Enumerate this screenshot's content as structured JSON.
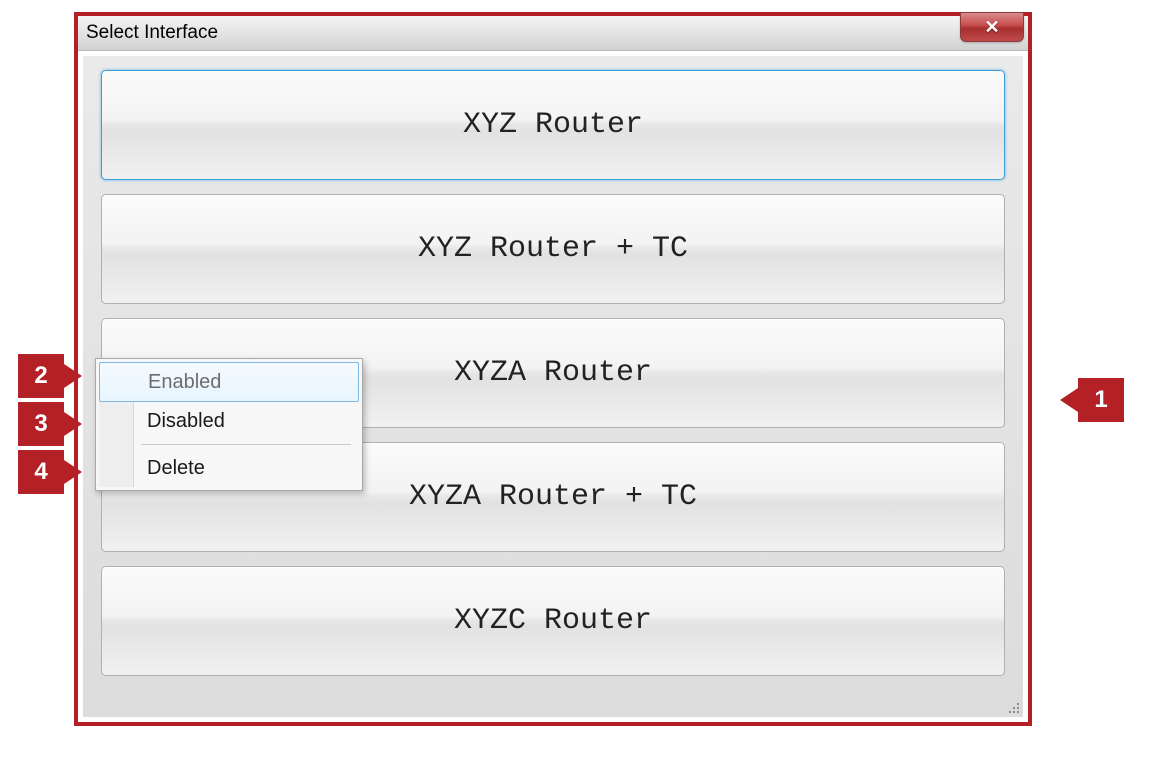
{
  "window": {
    "title": "Select Interface"
  },
  "interfaces": [
    {
      "label": "XYZ Router",
      "selected": true
    },
    {
      "label": "XYZ Router + TC",
      "selected": false
    },
    {
      "label": "XYZA Router",
      "selected": false
    },
    {
      "label": "XYZA Router + TC",
      "selected": false
    },
    {
      "label": "XYZC Router",
      "selected": false
    }
  ],
  "context_menu": {
    "items": [
      {
        "label": "Enabled",
        "highlighted": true
      },
      {
        "label": "Disabled",
        "highlighted": false
      }
    ],
    "after_separator": [
      {
        "label": "Delete",
        "highlighted": false
      }
    ]
  },
  "callouts": {
    "c1": "1",
    "c2": "2",
    "c3": "3",
    "c4": "4"
  }
}
